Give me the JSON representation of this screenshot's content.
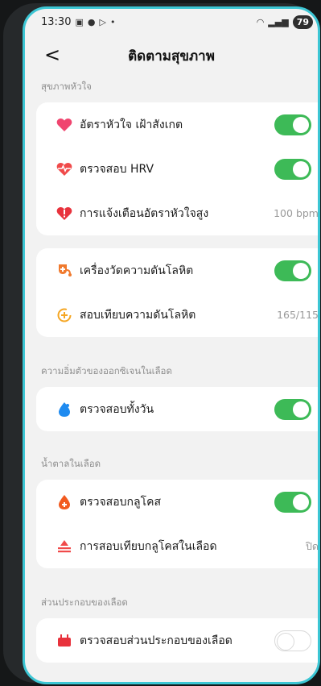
{
  "status_bar": {
    "time": "13:30",
    "battery": "79"
  },
  "header": {
    "back_label": "<",
    "title": "ติดตามสุขภาพ"
  },
  "sections": {
    "heart": {
      "label": "สุขภาพหัวใจ",
      "items": [
        {
          "label": "อัตราหัวใจ เฝ้าสังเกต",
          "toggle": true
        },
        {
          "label": "ตรวจสอบ HRV",
          "toggle": true
        },
        {
          "label": "การแจ้งเตือนอัตราหัวใจสูง",
          "value": "100 bpm"
        }
      ]
    },
    "bp": {
      "items": [
        {
          "label": "เครื่องวัดความดันโลหิต",
          "toggle": true
        },
        {
          "label": "สอบเทียบความดันโลหิต",
          "value": "165/115"
        }
      ]
    },
    "spo2": {
      "label": "ความอิ่มตัวของออกซิเจนในเลือด",
      "items": [
        {
          "label": "ตรวจสอบทั้งวัน",
          "toggle": true
        }
      ]
    },
    "glucose": {
      "label": "น้ำตาลในเลือด",
      "items": [
        {
          "label": "ตรวจสอบกลูโคส",
          "toggle": true
        },
        {
          "label": "การสอบเทียบกลูโคสในเลือด",
          "value": "ปิด"
        }
      ]
    },
    "composition": {
      "label": "ส่วนประกอบของเลือด",
      "items": [
        {
          "label": "ตรวจสอบส่วนประกอบของเลือด",
          "toggle": false
        }
      ]
    }
  },
  "colors": {
    "accent_green": "#3dba57",
    "frame_cyan": "#3cc6d4",
    "background": "#f2f2f2"
  }
}
